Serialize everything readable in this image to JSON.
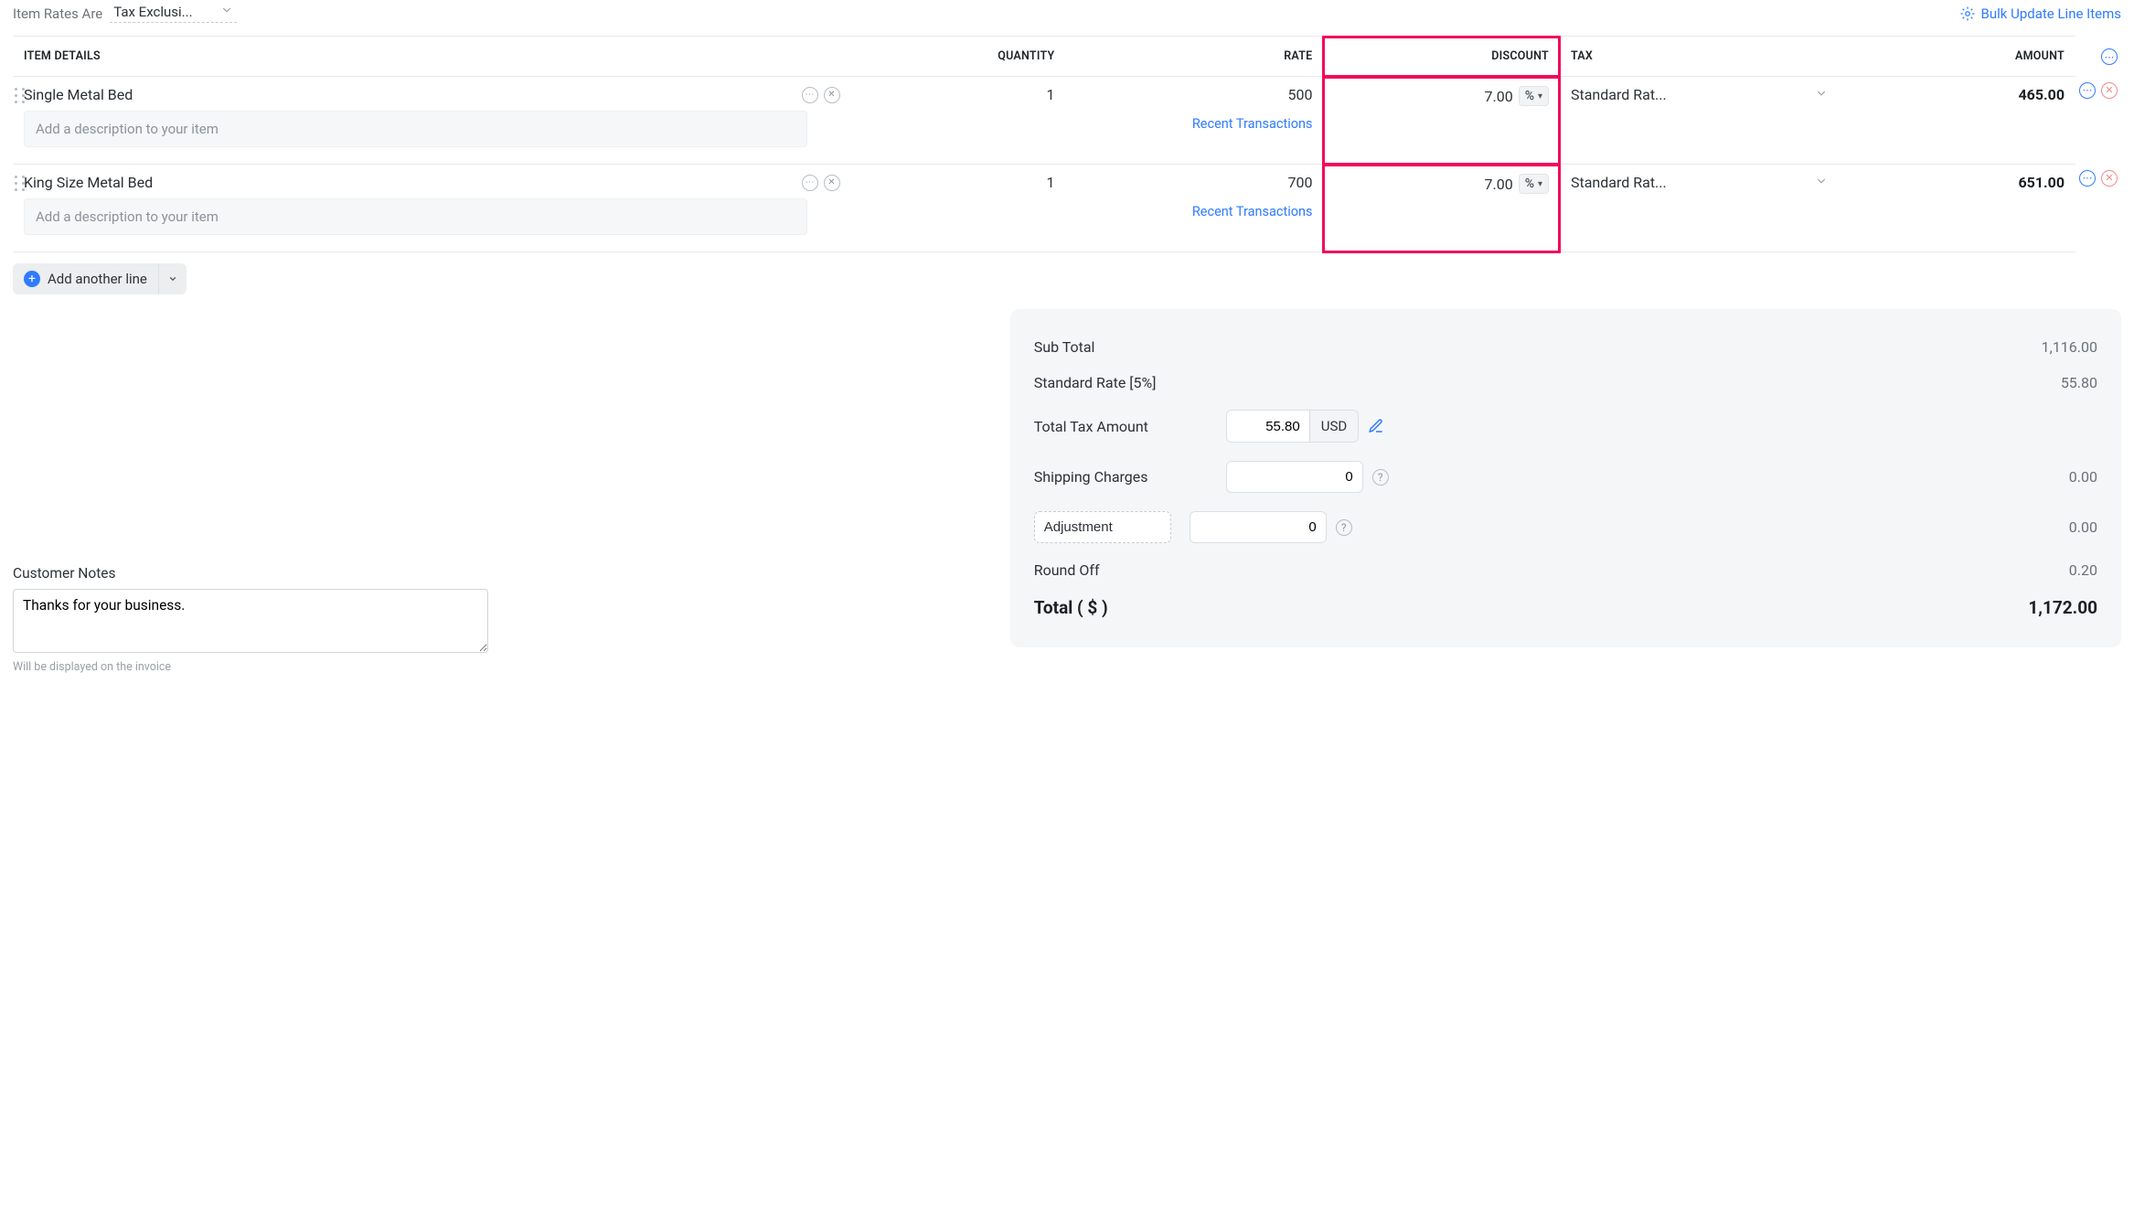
{
  "topbar": {
    "item_rates_label": "Item Rates Are",
    "tax_mode": "Tax Exclusi...",
    "bulk_update_label": "Bulk Update Line Items"
  },
  "table": {
    "headers": {
      "item_details": "ITEM DETAILS",
      "quantity": "QUANTITY",
      "rate": "RATE",
      "discount": "DISCOUNT",
      "tax": "TAX",
      "amount": "AMOUNT"
    },
    "desc_placeholder": "Add a description to your item",
    "recent_transactions_label": "Recent Transactions",
    "discount_unit": "%",
    "rows": [
      {
        "name": "Single Metal Bed",
        "quantity": "1",
        "rate": "500",
        "discount": "7.00",
        "tax": "Standard Rat...",
        "amount": "465.00"
      },
      {
        "name": "King Size Metal Bed",
        "quantity": "1",
        "rate": "700",
        "discount": "7.00",
        "tax": "Standard Rat...",
        "amount": "651.00"
      }
    ]
  },
  "add_line_label": "Add another line",
  "summary": {
    "sub_total_label": "Sub Total",
    "sub_total_value": "1,116.00",
    "tax_line_label": "Standard Rate [5%]",
    "tax_line_value": "55.80",
    "total_tax_label": "Total Tax Amount",
    "total_tax_value": "55.80",
    "currency_label": "USD",
    "shipping_label": "Shipping Charges",
    "shipping_input": "0",
    "shipping_value": "0.00",
    "adjustment_label": "Adjustment",
    "adjustment_input": "0",
    "adjustment_value": "0.00",
    "roundoff_label": "Round Off",
    "roundoff_value": "0.20",
    "total_label": "Total ( $ )",
    "total_value": "1,172.00"
  },
  "notes": {
    "title": "Customer Notes",
    "value": "Thanks for your business.",
    "hint": "Will be displayed on the invoice"
  },
  "highlight": {
    "discount_column": true
  }
}
